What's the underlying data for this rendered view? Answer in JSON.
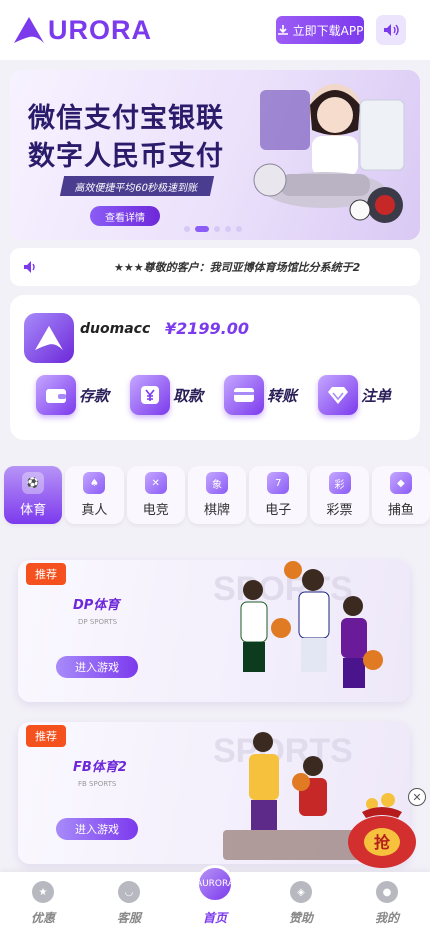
{
  "header": {
    "logo_text": "URORA",
    "download_label": "立即下载APP",
    "brand_color": "#7c3aed"
  },
  "banner": {
    "title_line1": "微信支付宝银联",
    "title_line2": "数字人民币支付",
    "subtitle": "高效便捷平均60秒极速到账",
    "detail_label": "查看详情",
    "active_dot": 2
  },
  "notice": {
    "text": "★★★尊敬的客户：我司亚博体育场馆比分系统于2"
  },
  "user": {
    "name": "duomacc",
    "balance": "¥2199.00",
    "actions": [
      {
        "label": "存款",
        "icon": "wallet-icon"
      },
      {
        "label": "取款",
        "icon": "yuan-icon"
      },
      {
        "label": "转账",
        "icon": "card-icon"
      },
      {
        "label": "注单",
        "icon": "diamond-icon"
      }
    ]
  },
  "categories": [
    {
      "label": "体育",
      "icon": "⚽",
      "active": true
    },
    {
      "label": "真人",
      "icon": "♠"
    },
    {
      "label": "电竞",
      "icon": "✕"
    },
    {
      "label": "棋牌",
      "icon": "象"
    },
    {
      "label": "电子",
      "icon": "7"
    },
    {
      "label": "彩票",
      "icon": "彩"
    },
    {
      "label": "捕鱼",
      "icon": "◆"
    }
  ],
  "games": [
    {
      "tag": "推荐",
      "name": "DP体育",
      "en": "DP SPORTS",
      "enter": "进入游戏"
    },
    {
      "tag": "推荐",
      "name": "FB体育2",
      "en": "FB SPORTS",
      "enter": "进入游戏"
    }
  ],
  "float": {
    "bag_text": "抢"
  },
  "nav": [
    {
      "label": "优惠",
      "icon": "star-icon"
    },
    {
      "label": "客服",
      "icon": "headset-icon"
    },
    {
      "label": "首页",
      "icon": "home-icon",
      "active": true,
      "badge": "AURORA"
    },
    {
      "label": "赞助",
      "icon": "compass-icon"
    },
    {
      "label": "我的",
      "icon": "user-icon"
    }
  ]
}
